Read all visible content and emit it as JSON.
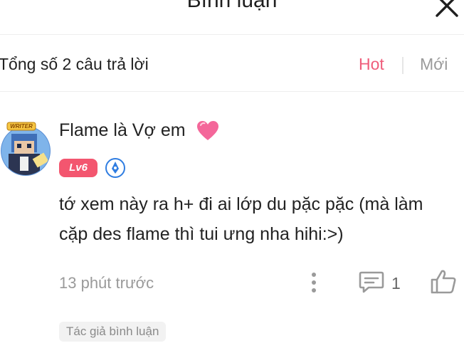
{
  "header": {
    "title": "Bình luận",
    "close_icon": "close-icon"
  },
  "summary": {
    "count_text": "Tổng số 2 câu trả lời",
    "sort_hot": "Hot",
    "sort_new": "Mới",
    "active_sort": "Hot",
    "accent_color": "#ef5d7b"
  },
  "comment": {
    "avatar_badge": "WRITER",
    "username": "Flame là Vợ em",
    "username_icon": "pink-heart-icon",
    "level": "Lv6",
    "badge_icon": "writer-pen-icon",
    "text_line1": "tớ xem này ra h+ đi ai lớp du pặc pặc (mà làm",
    "text_line2": "cặp des flame thì tui ưng nha hihi:>)",
    "time": "13 phút trước",
    "reply_count": "1",
    "author_tag": "Tác giả bình luận"
  }
}
